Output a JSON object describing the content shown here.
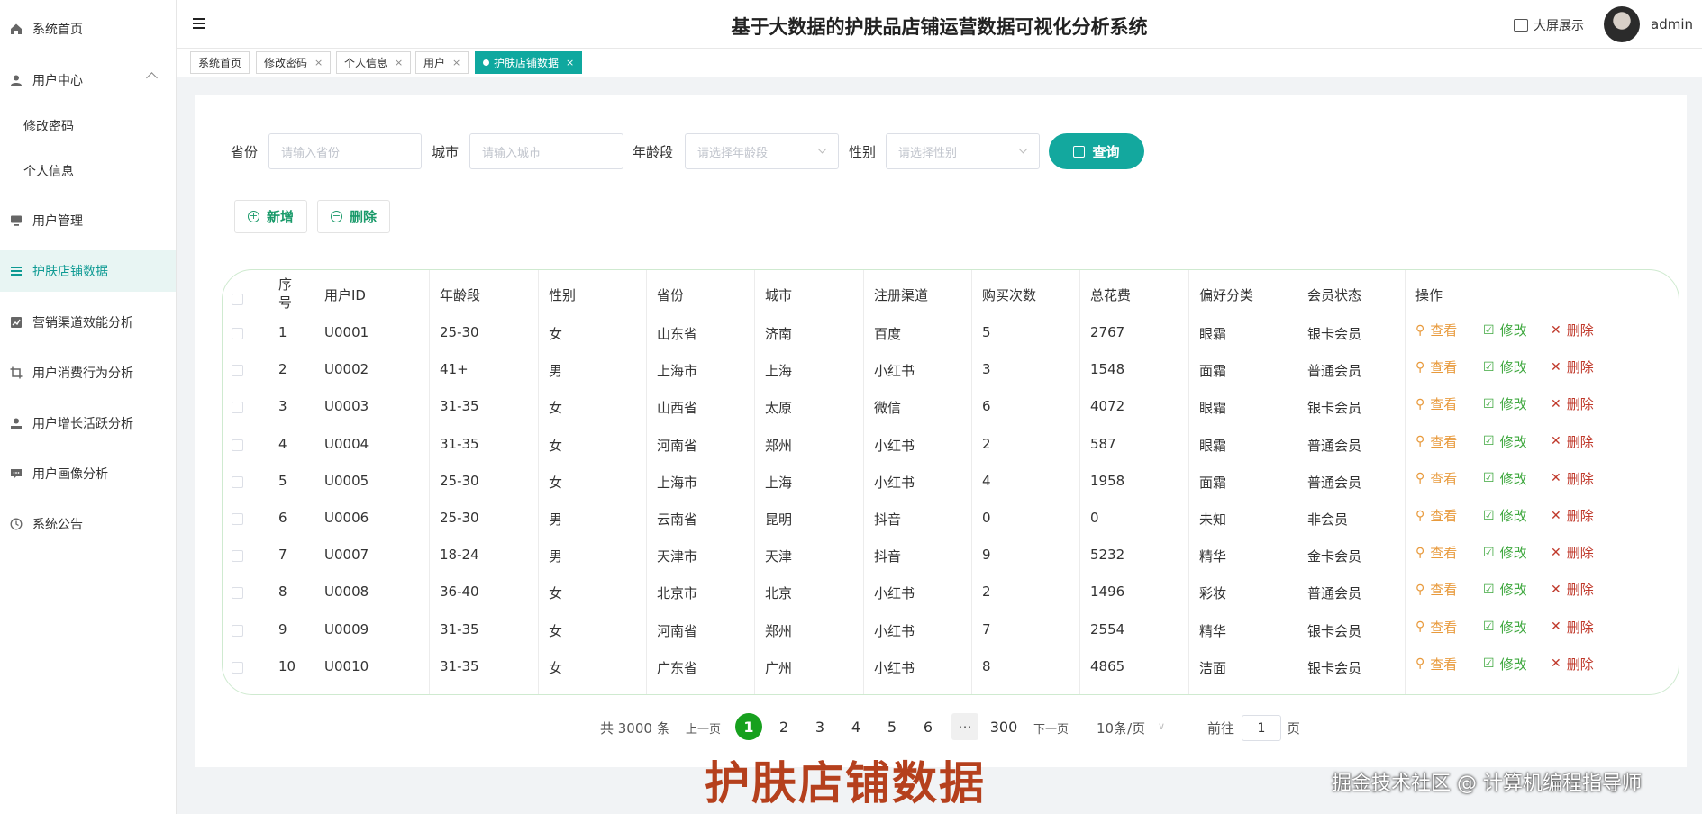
{
  "app": {
    "title": "基于大数据的护肤品店铺运营数据可视化分析系统",
    "big_screen": "大屏展示",
    "username": "admin"
  },
  "sidebar": {
    "items": [
      {
        "label": "系统首页",
        "icon": "home-icon"
      },
      {
        "label": "用户中心",
        "icon": "user-icon"
      },
      {
        "label": "修改密码",
        "icon": ""
      },
      {
        "label": "个人信息",
        "icon": ""
      },
      {
        "label": "用户管理",
        "icon": "monitor-icon"
      },
      {
        "label": "护肤店铺数据",
        "icon": "list-icon"
      },
      {
        "label": "营销渠道效能分析",
        "icon": "chart-icon"
      },
      {
        "label": "用户消费行为分析",
        "icon": "crop-icon"
      },
      {
        "label": "用户增长活跃分析",
        "icon": "user-plus-icon"
      },
      {
        "label": "用户画像分析",
        "icon": "message-icon"
      },
      {
        "label": "系统公告",
        "icon": "clock-icon"
      }
    ]
  },
  "tabs": [
    {
      "label": "系统首页"
    },
    {
      "label": "修改密码",
      "close": "×"
    },
    {
      "label": "个人信息",
      "close": "×"
    },
    {
      "label": "用户",
      "close": "×"
    },
    {
      "label": "护肤店铺数据",
      "close": "×"
    }
  ],
  "filters": {
    "province_label": "省份",
    "province_placeholder": "请输入省份",
    "city_label": "城市",
    "city_placeholder": "请输入城市",
    "age_label": "年龄段",
    "age_placeholder": "请选择年龄段",
    "gender_label": "性别",
    "gender_placeholder": "请选择性别",
    "query": "查询"
  },
  "toolbar": {
    "add": "新增",
    "delete": "删除"
  },
  "table": {
    "headers": [
      "序号",
      "用户ID",
      "年龄段",
      "性别",
      "省份",
      "城市",
      "注册渠道",
      "购买次数",
      "总花费",
      "偏好分类",
      "会员状态",
      "操作"
    ],
    "rows": [
      [
        "1",
        "U0001",
        "25-30",
        "女",
        "山东省",
        "济南",
        "百度",
        "5",
        "2767",
        "眼霜",
        "银卡会员"
      ],
      [
        "2",
        "U0002",
        "41+",
        "男",
        "上海市",
        "上海",
        "小红书",
        "3",
        "1548",
        "面霜",
        "普通会员"
      ],
      [
        "3",
        "U0003",
        "31-35",
        "女",
        "山西省",
        "太原",
        "微信",
        "6",
        "4072",
        "眼霜",
        "银卡会员"
      ],
      [
        "4",
        "U0004",
        "31-35",
        "女",
        "河南省",
        "郑州",
        "小红书",
        "2",
        "587",
        "眼霜",
        "普通会员"
      ],
      [
        "5",
        "U0005",
        "25-30",
        "女",
        "上海市",
        "上海",
        "小红书",
        "4",
        "1958",
        "面霜",
        "普通会员"
      ],
      [
        "6",
        "U0006",
        "25-30",
        "男",
        "云南省",
        "昆明",
        "抖音",
        "0",
        "0",
        "未知",
        "非会员"
      ],
      [
        "7",
        "U0007",
        "18-24",
        "男",
        "天津市",
        "天津",
        "抖音",
        "9",
        "5232",
        "精华",
        "金卡会员"
      ],
      [
        "8",
        "U0008",
        "36-40",
        "女",
        "北京市",
        "北京",
        "小红书",
        "2",
        "1496",
        "彩妆",
        "普通会员"
      ],
      [
        "9",
        "U0009",
        "31-35",
        "女",
        "河南省",
        "郑州",
        "小红书",
        "7",
        "2554",
        "精华",
        "银卡会员"
      ],
      [
        "10",
        "U0010",
        "31-35",
        "女",
        "广东省",
        "广州",
        "小红书",
        "8",
        "4865",
        "洁面",
        "银卡会员"
      ]
    ],
    "actions": {
      "view": "查看",
      "edit": "修改",
      "delete": "删除"
    }
  },
  "pagination": {
    "total": "共 3000 条",
    "prev": "上一页",
    "pages": [
      "1",
      "2",
      "3",
      "4",
      "5",
      "6"
    ],
    "more": "···",
    "last": "300",
    "next": "下一页",
    "page_size": "10条/页",
    "goto": "前往",
    "goto_value": "1",
    "page_unit": "页"
  },
  "overlay": {
    "caption": "护肤店铺数据",
    "watermark": "掘金技术社区 @ 计算机编程指导师"
  }
}
